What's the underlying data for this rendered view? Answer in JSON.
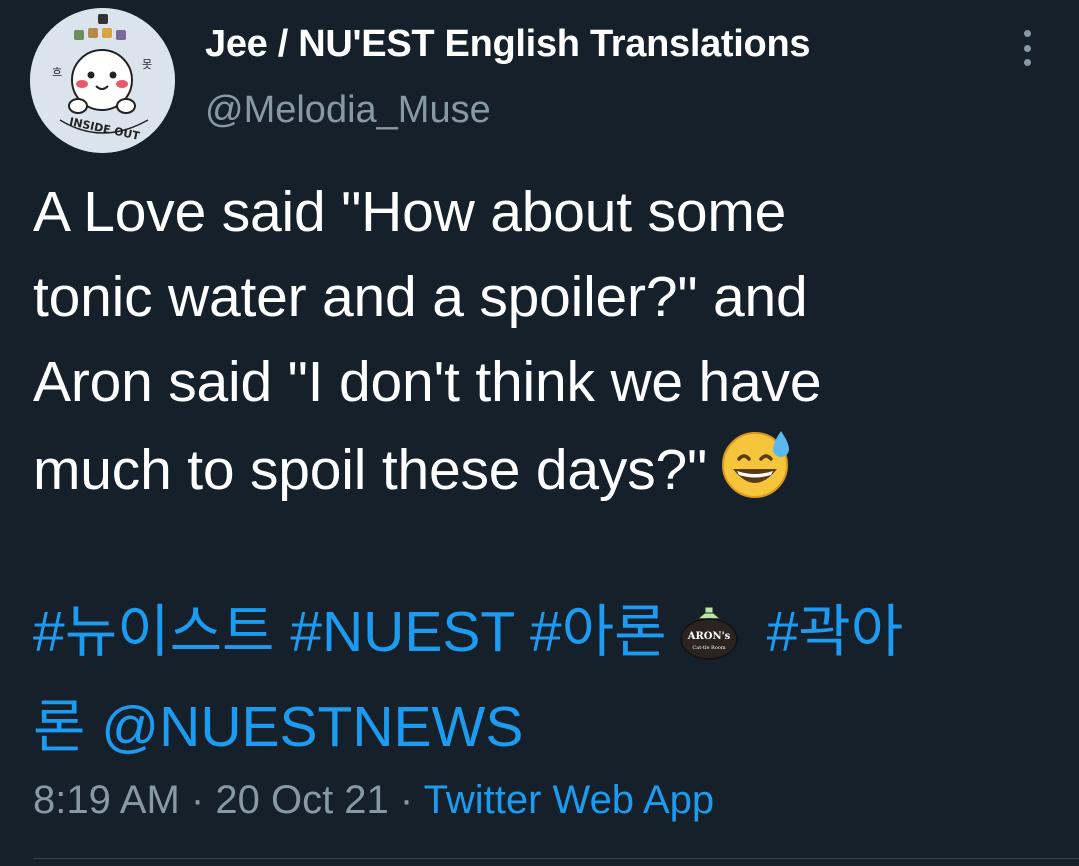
{
  "author": {
    "display_name": "Jee / NU'EST English Translations",
    "handle": "@Melodia_Muse",
    "avatar_icon": "avatar-cartoon-face",
    "avatar_text": "INSIDE OUT"
  },
  "tweet": {
    "text_lines": [
      "A Love said \"How about some",
      "tonic water and a spoiler?\" and",
      "Aron said \"I don't think we have",
      "much to spoil these days?\""
    ],
    "emoji": "grinning-face-with-sweat-icon",
    "hashtags": {
      "tag1": "#뉴이스트",
      "tag2": "#NUEST",
      "tag3": "#아론",
      "badge_text": "ARON's",
      "badge_subtext": "Cat-tle Room",
      "tag4_part1": "#곽아",
      "tag4_part2": "론",
      "mention": "@NUESTNEWS"
    },
    "time": "8:19 AM",
    "separator": "·",
    "date": "20 Oct 21",
    "source": "Twitter Web App"
  },
  "colors": {
    "background": "#15202b",
    "primary_text": "#ffffff",
    "secondary_text": "#8899a6",
    "link": "#1d9bf0",
    "divider": "#38444d"
  }
}
